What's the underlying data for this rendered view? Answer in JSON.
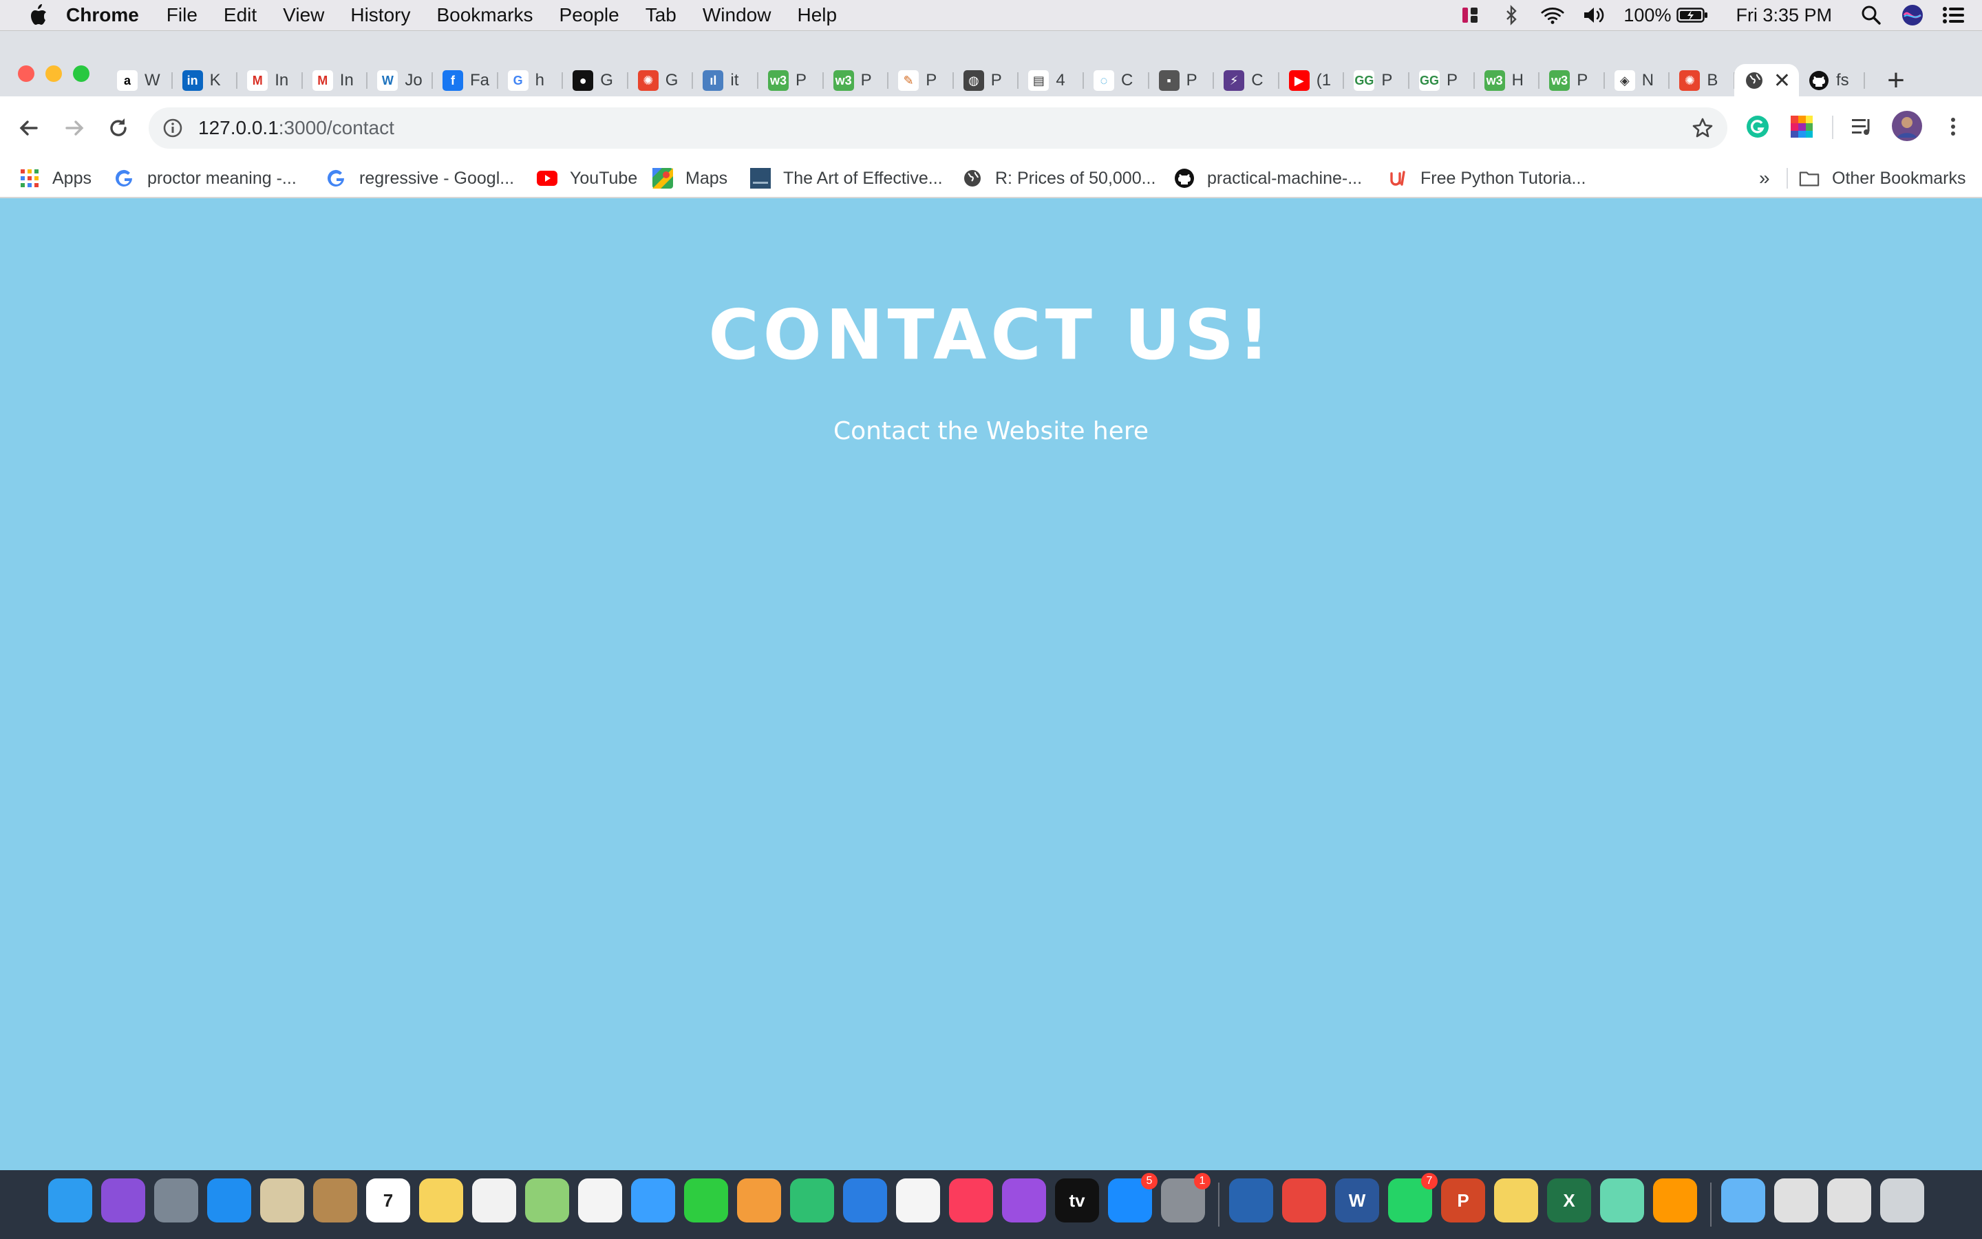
{
  "menubar": {
    "app_name": "Chrome",
    "items": [
      "File",
      "Edit",
      "View",
      "History",
      "Bookmarks",
      "People",
      "Tab",
      "Window",
      "Help"
    ],
    "battery": "100%",
    "clock": "Fri 3:35 PM"
  },
  "tabs": [
    {
      "letter": "W",
      "icon": "amazon-icon",
      "color": "#ffffff",
      "glyph": "a",
      "glyph_color": "#000"
    },
    {
      "letter": "K",
      "icon": "linkedin-icon",
      "color": "#0a66c2",
      "glyph": "in"
    },
    {
      "letter": "In",
      "icon": "gmail-icon",
      "color": "#ffffff",
      "glyph": "M",
      "glyph_color": "#d93025"
    },
    {
      "letter": "In",
      "icon": "gmail-icon",
      "color": "#ffffff",
      "glyph": "M",
      "glyph_color": "#d93025"
    },
    {
      "letter": "Jo",
      "icon": "wordpress-icon",
      "color": "#ffffff",
      "glyph": "W",
      "glyph_color": "#1e73be"
    },
    {
      "letter": "Fa",
      "icon": "facebook-icon",
      "color": "#1877f2",
      "glyph": "f"
    },
    {
      "letter": "h",
      "icon": "google-icon",
      "color": "#ffffff",
      "glyph": "G",
      "glyph_color": "#4285f4"
    },
    {
      "letter": "G",
      "icon": "github-icon",
      "color": "#111111",
      "glyph": "●"
    },
    {
      "letter": "G",
      "icon": "kaggle-icon",
      "color": "#e8442c",
      "glyph": "✺"
    },
    {
      "letter": "it",
      "icon": "app-icon",
      "color": "#4a7fc1",
      "glyph": "ıl"
    },
    {
      "letter": "P",
      "icon": "w3schools-icon",
      "color": "#4caf50",
      "glyph": "w3"
    },
    {
      "letter": "P",
      "icon": "w3schools-icon",
      "color": "#4caf50",
      "glyph": "w3"
    },
    {
      "letter": "P",
      "icon": "pen-icon",
      "color": "#ffffff",
      "glyph": "✎",
      "glyph_color": "#d2691e"
    },
    {
      "letter": "P",
      "icon": "globe-icon",
      "color": "#444444",
      "glyph": "◍"
    },
    {
      "letter": "4",
      "icon": "document-icon",
      "color": "#ffffff",
      "glyph": "▤",
      "glyph_color": "#333"
    },
    {
      "letter": "C",
      "icon": "loading-icon",
      "color": "#ffffff",
      "glyph": "◌",
      "glyph_color": "#1e9bd7"
    },
    {
      "letter": "P",
      "icon": "folder-icon",
      "color": "#555555",
      "glyph": "▪"
    },
    {
      "letter": "C",
      "icon": "lightning-icon",
      "color": "#5b3b8c",
      "glyph": "⚡"
    },
    {
      "letter": "(1",
      "icon": "youtube-icon",
      "color": "#ff0000",
      "glyph": "▶"
    },
    {
      "letter": "P",
      "icon": "geeksforgeeks-icon",
      "color": "#ffffff",
      "glyph": "GG",
      "glyph_color": "#2f8d46"
    },
    {
      "letter": "P",
      "icon": "geeksforgeeks-icon",
      "color": "#ffffff",
      "glyph": "GG",
      "glyph_color": "#2f8d46"
    },
    {
      "letter": "H",
      "icon": "w3schools-icon",
      "color": "#4caf50",
      "glyph": "w3"
    },
    {
      "letter": "P",
      "icon": "w3schools-icon",
      "color": "#4caf50",
      "glyph": "w3"
    },
    {
      "letter": "N",
      "icon": "node-icon",
      "color": "#ffffff",
      "glyph": "◈",
      "glyph_color": "#333"
    },
    {
      "letter": "B",
      "icon": "kaggle-icon",
      "color": "#e8442c",
      "glyph": "✺"
    }
  ],
  "active_tab": {
    "icon": "globe-icon"
  },
  "last_tab": {
    "letter": "fs",
    "icon": "github-icon"
  },
  "omnibox": {
    "host": "127.0.0.1",
    "path": ":3000/contact"
  },
  "bookmarks": [
    {
      "label": "Apps",
      "icon": "apps-grid-icon"
    },
    {
      "label": "proctor meaning -...",
      "icon": "google-icon"
    },
    {
      "label": "regressive - Googl...",
      "icon": "google-icon"
    },
    {
      "label": "YouTube",
      "icon": "youtube-icon"
    },
    {
      "label": "Maps",
      "icon": "maps-icon"
    },
    {
      "label": "The Art of Effective...",
      "icon": "book-icon"
    },
    {
      "label": "R: Prices of 50,000...",
      "icon": "globe-icon"
    },
    {
      "label": "practical-machine-...",
      "icon": "github-icon"
    },
    {
      "label": "Free Python Tutoria...",
      "icon": "udemy-icon"
    }
  ],
  "bookmarks_overflow": "»",
  "other_bookmarks": "Other Bookmarks",
  "page": {
    "heading": "CONTACT US!",
    "subtext": "Contact the Website here",
    "background": "#87ceeb"
  },
  "dock": {
    "items": [
      {
        "name": "finder-icon",
        "color": "#2d9cf0"
      },
      {
        "name": "siri-icon",
        "color": "#8a4fd8"
      },
      {
        "name": "launchpad-icon",
        "color": "#7b8794"
      },
      {
        "name": "safari-icon",
        "color": "#1f8ef1"
      },
      {
        "name": "mail-icon",
        "color": "#d8c9a3"
      },
      {
        "name": "contacts-icon",
        "color": "#b5884f"
      },
      {
        "name": "calendar-icon",
        "color": "#ffffff",
        "text": "7"
      },
      {
        "name": "notes-icon",
        "color": "#f7d35c"
      },
      {
        "name": "reminders-icon",
        "color": "#f2f2f2"
      },
      {
        "name": "maps-icon",
        "color": "#8fcf75"
      },
      {
        "name": "photos-icon",
        "color": "#f4f4f4"
      },
      {
        "name": "messages-icon",
        "color": "#3aa0ff"
      },
      {
        "name": "facetime-icon",
        "color": "#2ecc40"
      },
      {
        "name": "pages-icon",
        "color": "#f39c3b"
      },
      {
        "name": "numbers-icon",
        "color": "#2fbf71"
      },
      {
        "name": "keynote-icon",
        "color": "#2a7de1"
      },
      {
        "name": "news-icon",
        "color": "#f5f5f5"
      },
      {
        "name": "music-icon",
        "color": "#fb3c5c"
      },
      {
        "name": "podcasts-icon",
        "color": "#9b4ee0"
      },
      {
        "name": "tv-icon",
        "color": "#111111",
        "text": "tv"
      },
      {
        "name": "app-store-icon",
        "color": "#1a8cff",
        "badge": "5"
      },
      {
        "name": "system-preferences-icon",
        "color": "#8a8f96",
        "badge": "1"
      },
      {
        "name": "virtualbox-icon",
        "color": "#2864b0"
      },
      {
        "name": "chrome-icon",
        "color": "#e8453c"
      },
      {
        "name": "word-icon",
        "color": "#2b579a",
        "text": "W"
      },
      {
        "name": "whatsapp-icon",
        "color": "#25d366",
        "badge": "7"
      },
      {
        "name": "powerpoint-icon",
        "color": "#d24726",
        "text": "P"
      },
      {
        "name": "python-icon",
        "color": "#f4d35e"
      },
      {
        "name": "excel-icon",
        "color": "#217346",
        "text": "X"
      },
      {
        "name": "atom-icon",
        "color": "#66d7b0"
      },
      {
        "name": "sublime-icon",
        "color": "#ff9800"
      },
      {
        "name": "folder-icon",
        "color": "#64b5f6"
      },
      {
        "name": "document-icon",
        "color": "#e0e0e0"
      },
      {
        "name": "document-icon",
        "color": "#e0e0e0"
      },
      {
        "name": "trash-icon",
        "color": "#d0d4d8"
      }
    ]
  }
}
